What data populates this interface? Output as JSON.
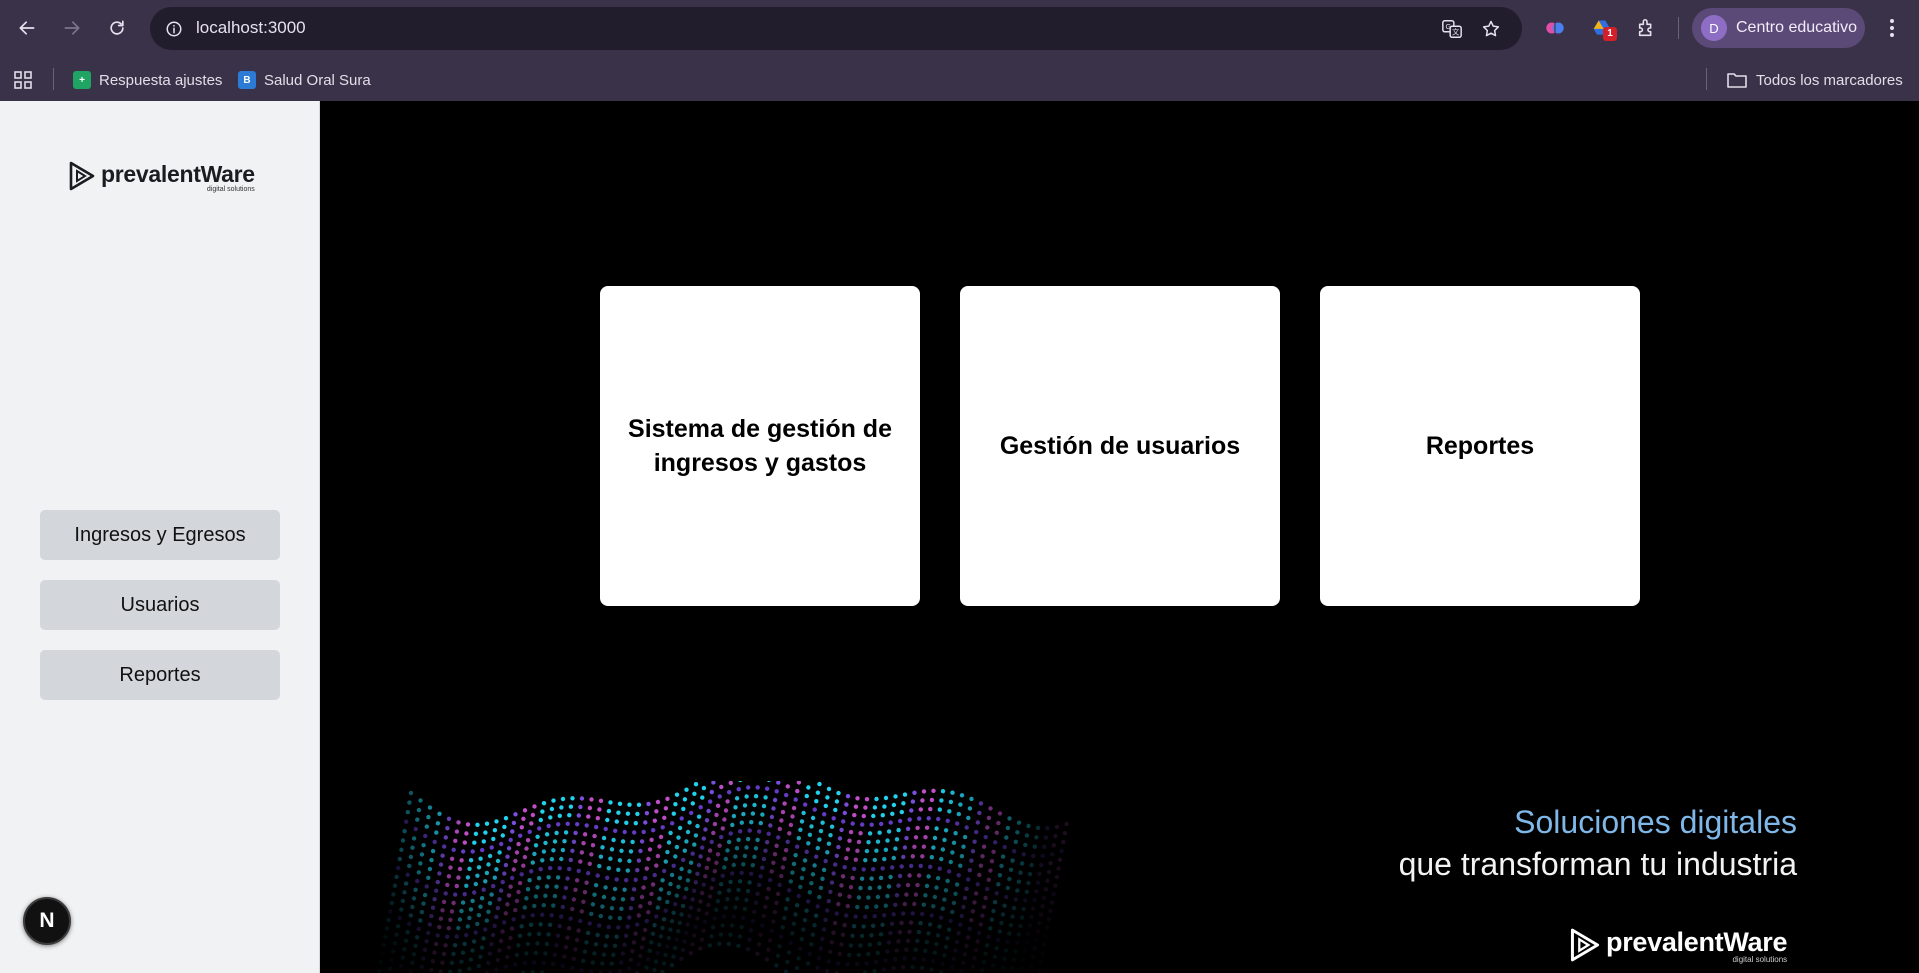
{
  "browser": {
    "url": "localhost:3000",
    "profile_initial": "D",
    "profile_name": "Centro educativo",
    "extension_badge": "1",
    "bookmarks": [
      {
        "label": "Respuesta ajustes",
        "icon": "sheets-icon"
      },
      {
        "label": "Salud Oral Sura",
        "icon": "bookmark-site-icon"
      }
    ],
    "all_bookmarks_label": "Todos los marcadores"
  },
  "sidebar": {
    "logo_name": "prevalentWare",
    "logo_tagline": "digital solutions",
    "items": [
      {
        "label": "Ingresos y Egresos"
      },
      {
        "label": "Usuarios"
      },
      {
        "label": "Reportes"
      }
    ],
    "dev_badge": "N"
  },
  "main": {
    "cards": [
      {
        "title": "Sistema de gestión de ingresos y gastos"
      },
      {
        "title": "Gestión de usuarios"
      },
      {
        "title": "Reportes"
      }
    ],
    "banner": {
      "line1": "Soluciones digitales",
      "line2": "que transforman tu industria",
      "brand": "prevalentWare",
      "brand_tagline": "digital solutions"
    }
  },
  "colors": {
    "chrome_bg": "#3a3248",
    "omnibox_bg": "#221d2c",
    "sidebar_bg": "#f1f2f4",
    "sidebar_button_bg": "#d3d6db",
    "main_bg": "#000000",
    "slogan_accent": "#7fb8e8"
  }
}
